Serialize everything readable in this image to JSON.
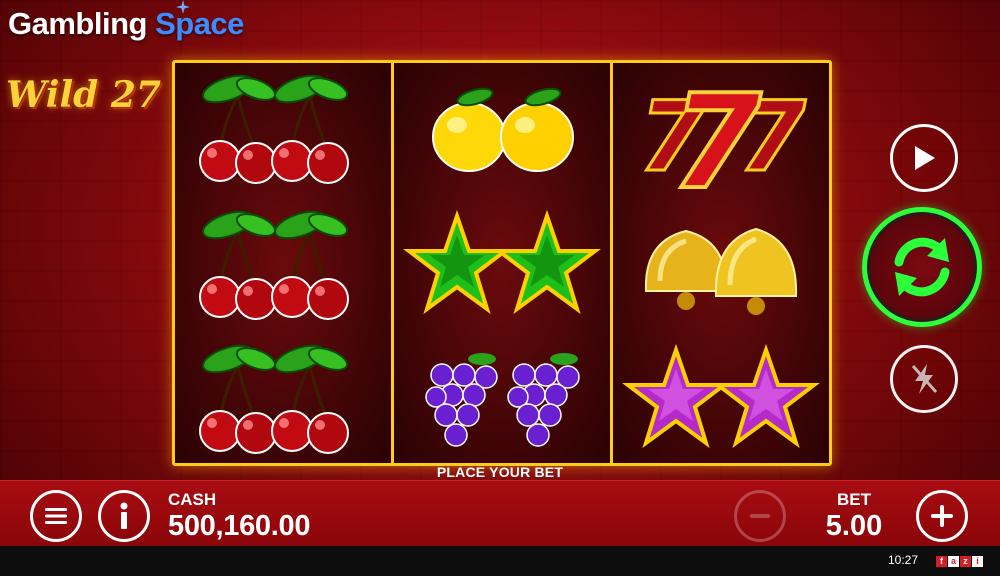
{
  "brand": {
    "word1": "Gambling",
    "word2": "Space"
  },
  "game": {
    "logo": "Wild 27"
  },
  "reels": [
    [
      "cherries-icon",
      "cherries-icon",
      "cherries-icon"
    ],
    [
      "lemons-icon",
      "green-stars-icon",
      "grapes-icon"
    ],
    [
      "seven-icon",
      "bells-icon",
      "purple-stars-icon"
    ]
  ],
  "message": "PLACE YOUR BET",
  "controls": {
    "play": "play-icon",
    "spin": "spin-arrows-icon",
    "turbo": "lightning-off-icon",
    "menu": "menu-icon",
    "info": "info-icon",
    "minus": "minus-icon",
    "plus": "plus-icon"
  },
  "cash": {
    "label": "CASH",
    "value": "500,160.00"
  },
  "bet": {
    "label": "BET",
    "value": "5.00"
  },
  "status": {
    "time": "10:27",
    "provider": [
      "f",
      "a",
      "z",
      "i"
    ]
  },
  "colors": {
    "frame": "#ffcc1a",
    "spin_ring": "#2bff3a",
    "brand_accent": "#3b8cff",
    "background": "#8a0a0e"
  }
}
